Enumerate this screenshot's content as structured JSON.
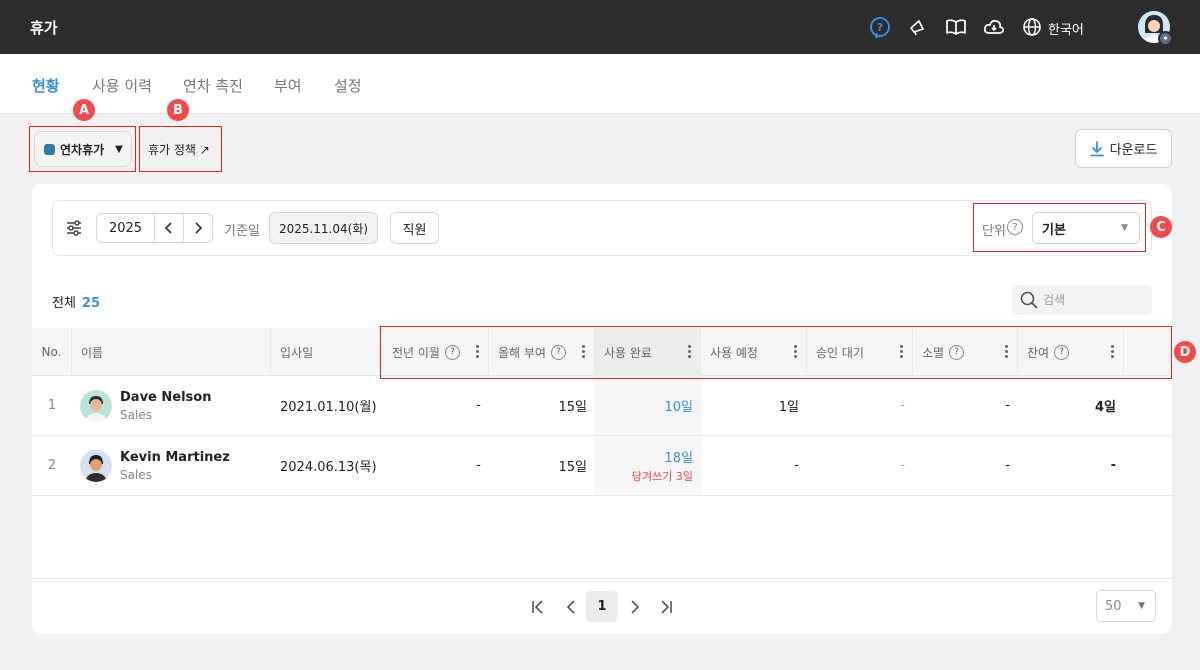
{
  "app": {
    "title": "휴가",
    "language": "한국어"
  },
  "tabs": [
    {
      "label": "현황",
      "active": true
    },
    {
      "label": "사용 이력",
      "active": false
    },
    {
      "label": "연차 촉진",
      "active": false
    },
    {
      "label": "부여",
      "active": false
    },
    {
      "label": "설정",
      "active": false
    }
  ],
  "markers": {
    "a": "A",
    "b": "B",
    "c": "C",
    "d": "D"
  },
  "toolbar": {
    "leave_type": "연차휴가",
    "leave_color": "#2f7ea0",
    "policy_link": "휴가 정책 ↗",
    "download": "다운로드"
  },
  "filter": {
    "year": "2025",
    "base_date_label": "기준일",
    "base_date": "2025.11.04(화)",
    "employee_btn": "직원",
    "unit_label": "단위",
    "unit_value": "기본"
  },
  "summary": {
    "total_label": "전체",
    "total_count": "25"
  },
  "search": {
    "placeholder": "검색"
  },
  "table": {
    "headers": {
      "no": "No.",
      "name": "이름",
      "join": "입사일",
      "carry": "전년 이월",
      "granted": "올해 부여",
      "used": "사용 완료",
      "planned": "사용 예정",
      "pending": "승인 대기",
      "expired": "소멸",
      "remaining": "잔여"
    },
    "rows": [
      {
        "no": "1",
        "name": "Dave Nelson",
        "dept": "Sales",
        "join": "2021.01.10(월)",
        "carry": "-",
        "granted": "15일",
        "used": "10일",
        "used_note": "",
        "planned": "1일",
        "pending": "-",
        "expired": "-",
        "remaining": "4일"
      },
      {
        "no": "2",
        "name": "Kevin Martinez",
        "dept": "Sales",
        "join": "2024.06.13(목)",
        "carry": "-",
        "granted": "15일",
        "used": "18일",
        "used_note": "당겨쓰기 3일",
        "planned": "-",
        "pending": "-",
        "expired": "-",
        "remaining": "-"
      }
    ]
  },
  "pagination": {
    "current": "1",
    "per_page": "50"
  },
  "colors": {
    "accent": "#3b8fe0",
    "marker": "#f04a4a",
    "highlight": "#d9252b",
    "alert": "#e5484d"
  }
}
